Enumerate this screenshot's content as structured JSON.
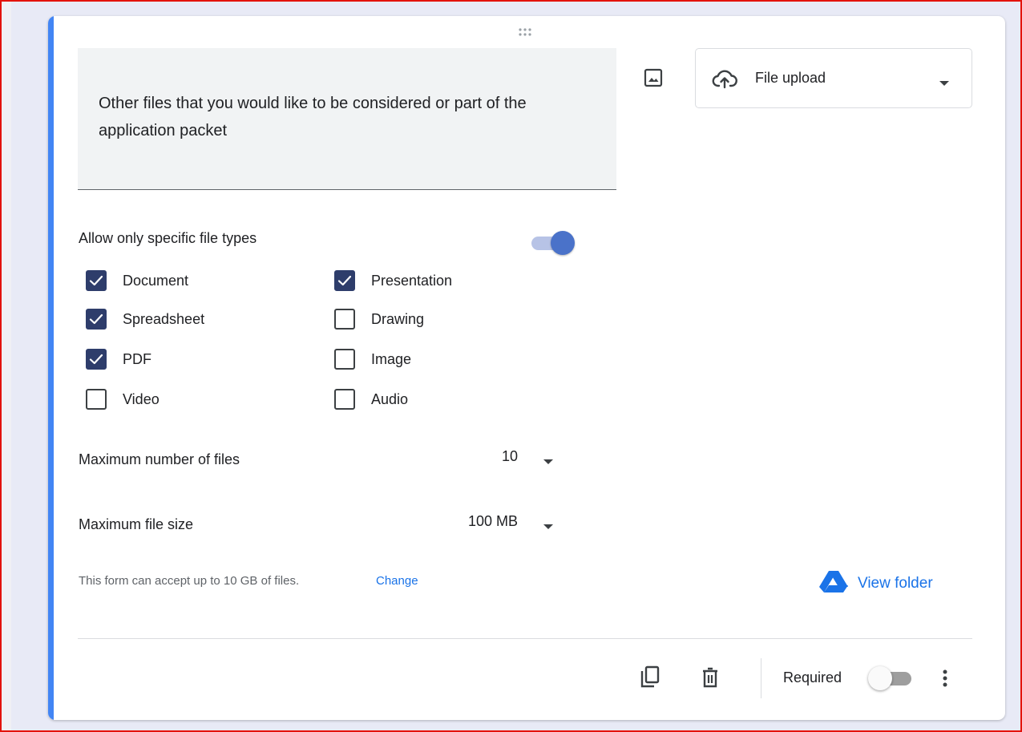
{
  "question": {
    "title": "Other files that you would like to be considered or part of the application packet"
  },
  "type_select": {
    "label": "File upload",
    "icon": "cloud-upload-icon"
  },
  "file_types": {
    "label": "Allow only specific file types",
    "enabled": true,
    "options": [
      {
        "label": "Document",
        "checked": true
      },
      {
        "label": "Presentation",
        "checked": true
      },
      {
        "label": "Spreadsheet",
        "checked": true
      },
      {
        "label": "Drawing",
        "checked": false
      },
      {
        "label": "PDF",
        "checked": true
      },
      {
        "label": "Image",
        "checked": false
      },
      {
        "label": "Video",
        "checked": false
      },
      {
        "label": "Audio",
        "checked": false
      }
    ]
  },
  "max_files": {
    "label": "Maximum number of files",
    "value": "10"
  },
  "max_size": {
    "label": "Maximum file size",
    "value": "100 MB"
  },
  "footer": {
    "note": "This form can accept up to 10 GB of files.",
    "change_link": "Change",
    "view_folder": "View folder"
  },
  "toolbar": {
    "required_label": "Required",
    "required": false
  },
  "colors": {
    "accent": "#4285f4",
    "checkbox_checked": "#2e3d6b",
    "link": "#1a73e8",
    "toggle_on": "#4a72c9"
  }
}
